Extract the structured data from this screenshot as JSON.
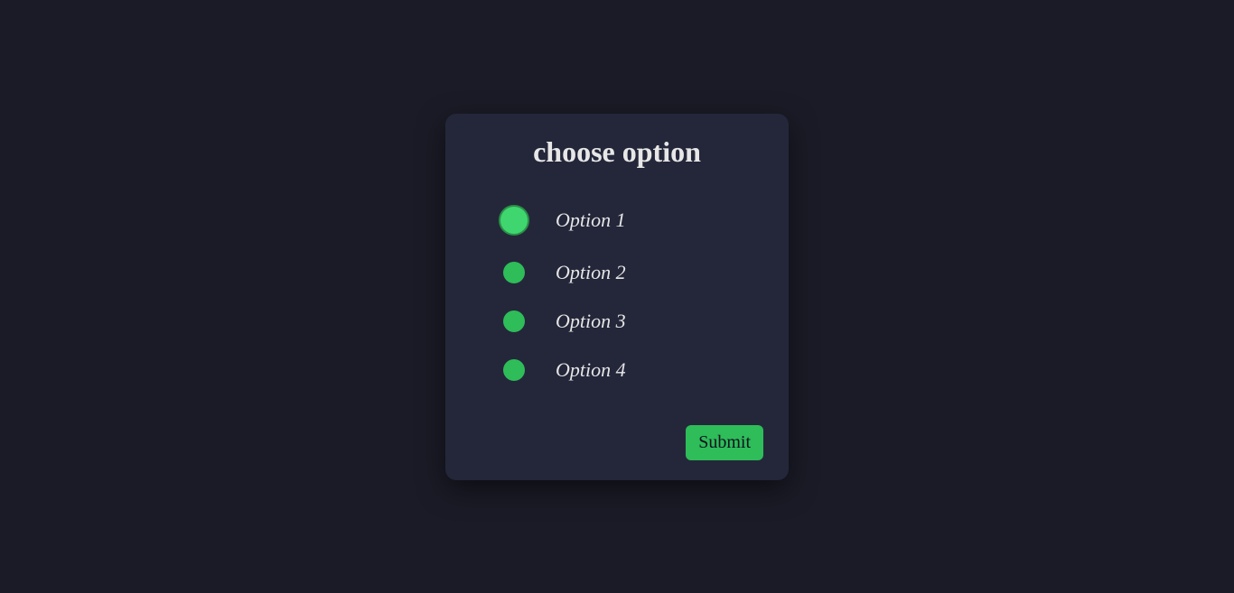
{
  "card": {
    "title": "choose option",
    "options": [
      {
        "label": "Option 1",
        "selected": true
      },
      {
        "label": "Option 2",
        "selected": false
      },
      {
        "label": "Option 3",
        "selected": false
      },
      {
        "label": "Option 4",
        "selected": false
      }
    ],
    "submit_label": "Submit"
  },
  "colors": {
    "background": "#1a1b26",
    "card": "#24273a",
    "accent": "#2ebd59",
    "text": "#e6e6e6"
  }
}
